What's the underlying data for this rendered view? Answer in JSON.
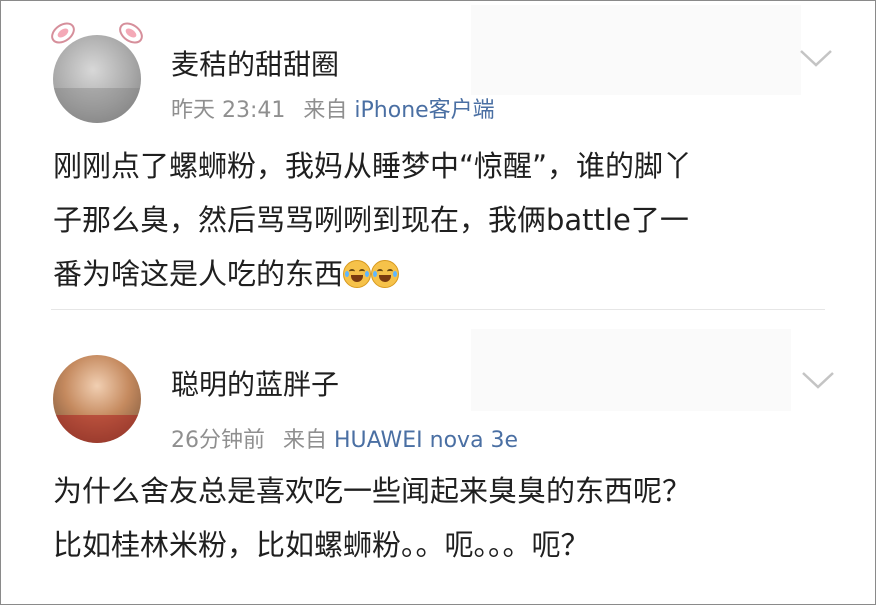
{
  "posts": [
    {
      "username": "麦秸的甜甜圈",
      "time": "昨天 23:41",
      "from_label": "来自",
      "device": "iPhone客户端",
      "text": "刚刚点了螺蛳粉，我妈从睡梦中“惊醒”，谁的脚丫\n子那么臭，然后骂骂咧咧到现在，我俩battle了一\n番为啥这是人吃的东西",
      "emojis": [
        "laugh-cry-emoji",
        "laugh-cry-emoji"
      ]
    },
    {
      "username": "聪明的蓝胖子",
      "time": "26分钟前",
      "from_label": "来自",
      "device": "HUAWEI nova 3e",
      "text": "为什么舍友总是喜欢吃一些闻起来臭臭的东西呢？\n比如桂林米粉，比如螺蛳粉。。呃。。。呃？"
    }
  ],
  "colors": {
    "text": "#1f1f1f",
    "meta": "#8f8f8f",
    "device_link": "#4a6fa3"
  },
  "icons": [
    "bunny-ears-icon",
    "chevron-down-icon"
  ]
}
